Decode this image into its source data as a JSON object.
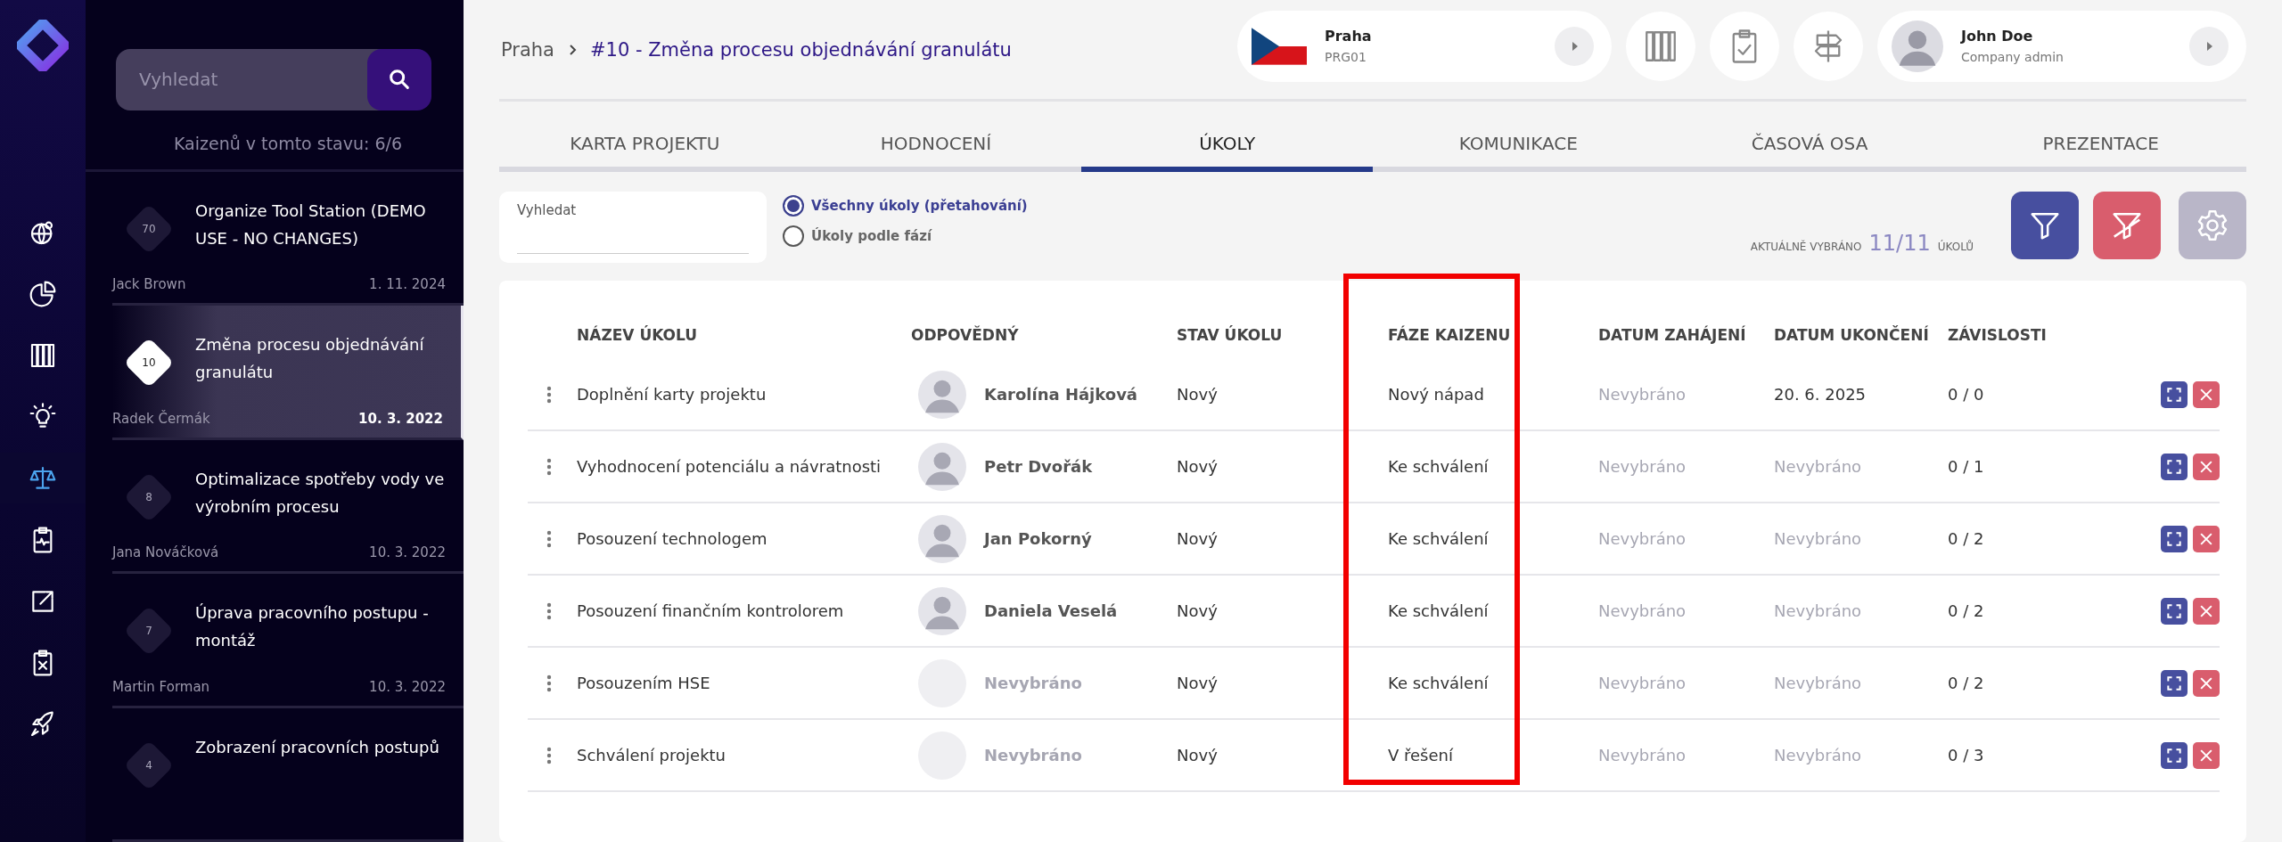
{
  "rail": {
    "items": [
      {
        "kind": "globe",
        "selected": false
      },
      {
        "kind": "pie",
        "selected": false
      },
      {
        "kind": "columns",
        "selected": false
      },
      {
        "kind": "bulb",
        "selected": false
      },
      {
        "kind": "scales",
        "selected": true
      },
      {
        "kind": "clipboard-pulse",
        "selected": false
      },
      {
        "kind": "export",
        "selected": false
      },
      {
        "kind": "clipboard-x",
        "selected": false
      },
      {
        "kind": "rocket",
        "selected": false
      }
    ]
  },
  "sidebar": {
    "search": {
      "placeholder": "Vyhledat"
    },
    "count": "Kaizenů v tomto stavu: 6/6",
    "items": [
      {
        "number": "70",
        "title": "Organize Tool Station (DEMO USE - NO CHANGES)",
        "author": "Jack Brown",
        "date": "1. 11. 2024",
        "selected": false
      },
      {
        "number": "10",
        "title": "Změna procesu objednávání granulátu",
        "author": "Radek Čermák",
        "date": "10. 3. 2022",
        "selected": true
      },
      {
        "number": "8",
        "title": "Optimalizace spotřeby vody ve výrobním procesu",
        "author": "Jana Nováčková",
        "date": "10. 3. 2022",
        "selected": false
      },
      {
        "number": "7",
        "title": "Úprava pracovního postupu - montáž",
        "author": "Martin Forman",
        "date": "10. 3. 2022",
        "selected": false
      },
      {
        "number": "4",
        "title": "Zobrazení pracovních postupů",
        "selected": false
      }
    ]
  },
  "breadcrumb": [
    "Praha",
    "#10 - Změna procesu objednávání granulátu"
  ],
  "location": {
    "name": "Praha",
    "code": "PRG01"
  },
  "toolbar": [
    {
      "kind": "columns"
    },
    {
      "kind": "clipboard-check"
    },
    {
      "kind": "signpost"
    }
  ],
  "user": {
    "name": "John Doe",
    "role": "Company admin"
  },
  "tabs": [
    {
      "label": "KARTA PROJEKTU",
      "selected": false
    },
    {
      "label": "HODNOCENÍ",
      "selected": false
    },
    {
      "label": "ÚKOLY",
      "selected": true
    },
    {
      "label": "KOMUNIKACE",
      "selected": false
    },
    {
      "label": "ČASOVÁ OSA",
      "selected": false
    },
    {
      "label": "PREZENTACE",
      "selected": false
    }
  ],
  "filter": {
    "search": {
      "label": "Vyhledat"
    },
    "view_options": [
      {
        "label": "Všechny úkoly (přetahování)",
        "selected": true
      },
      {
        "label": "Úkoly podle fází",
        "selected": false
      }
    ],
    "selection": {
      "prefix": "AKTUÁLNĚ VYBRÁNO",
      "count": "11/11",
      "suffix": "ÚKOLŮ"
    }
  },
  "table": {
    "columns": [
      {
        "label": "NÁZEV ÚKOLU",
        "highlighted": false
      },
      {
        "label": "ODPOVĚDNÝ",
        "highlighted": false
      },
      {
        "label": "STAV ÚKOLU",
        "highlighted": false
      },
      {
        "label": "FÁZE KAIZENU",
        "highlighted": true
      },
      {
        "label": "DATUM ZAHÁJENÍ",
        "highlighted": false
      },
      {
        "label": "DATUM UKONČENÍ",
        "highlighted": false
      },
      {
        "label": "ZÁVISLOSTI",
        "highlighted": false
      }
    ],
    "rows": [
      {
        "task": "Doplnění karty projektu",
        "assignee": {
          "name": "Karolína Hájková",
          "assigned": true
        },
        "status": "Nový",
        "phase": "Nový nápad",
        "start": {
          "text": "Nevybráno",
          "set": false
        },
        "end": {
          "text": "20. 6. 2025",
          "set": true
        },
        "dependencies": "0 / 0"
      },
      {
        "task": "Vyhodnocení potenciálu a návratnosti",
        "assignee": {
          "name": "Petr Dvořák",
          "assigned": true
        },
        "status": "Nový",
        "phase": "Ke schválení",
        "start": {
          "text": "Nevybráno",
          "set": false
        },
        "end": {
          "text": "Nevybráno",
          "set": false
        },
        "dependencies": "0 / 1"
      },
      {
        "task": "Posouzení technologem",
        "assignee": {
          "name": "Jan Pokorný",
          "assigned": true
        },
        "status": "Nový",
        "phase": "Ke schválení",
        "start": {
          "text": "Nevybráno",
          "set": false
        },
        "end": {
          "text": "Nevybráno",
          "set": false
        },
        "dependencies": "0 / 2"
      },
      {
        "task": "Posouzení finančním kontrolorem",
        "assignee": {
          "name": "Daniela Veselá",
          "assigned": true
        },
        "status": "Nový",
        "phase": "Ke schválení",
        "start": {
          "text": "Nevybráno",
          "set": false
        },
        "end": {
          "text": "Nevybráno",
          "set": false
        },
        "dependencies": "0 / 2"
      },
      {
        "task": "Posouzením HSE",
        "assignee": {
          "name": "Nevybráno",
          "assigned": false
        },
        "status": "Nový",
        "phase": "Ke schválení",
        "start": {
          "text": "Nevybráno",
          "set": false
        },
        "end": {
          "text": "Nevybráno",
          "set": false
        },
        "dependencies": "0 / 2"
      },
      {
        "task": "Schválení projektu",
        "assignee": {
          "name": "Nevybráno",
          "assigned": false
        },
        "status": "Nový",
        "phase": "V řešení",
        "start": {
          "text": "Nevybráno",
          "set": false
        },
        "end": {
          "text": "Nevybráno",
          "set": false
        },
        "dependencies": "0 / 3"
      }
    ]
  }
}
